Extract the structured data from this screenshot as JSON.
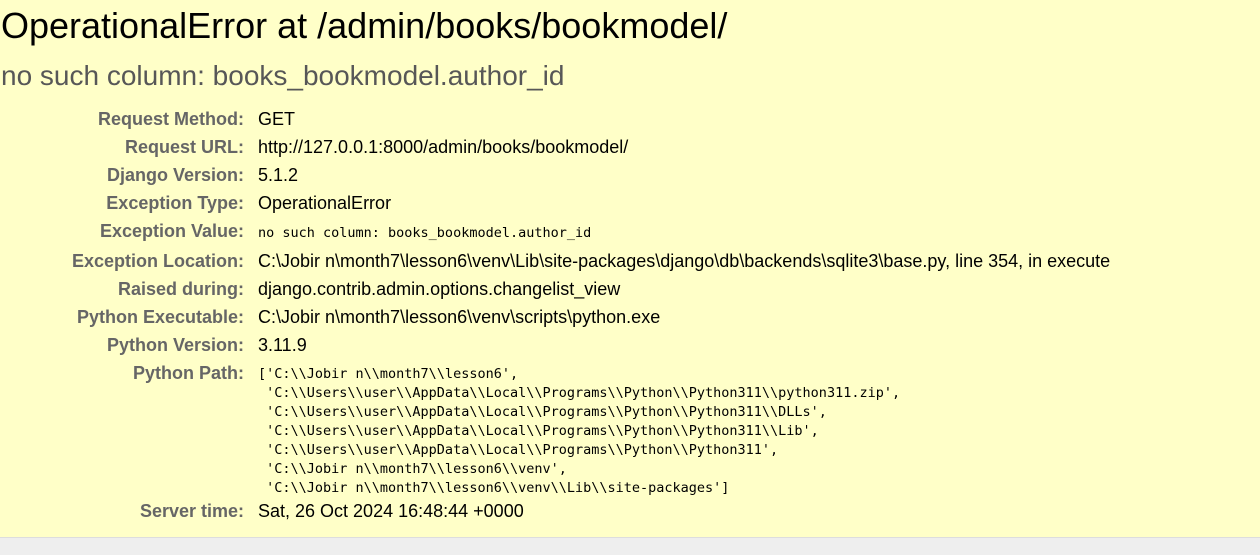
{
  "error": {
    "title": "OperationalError at /admin/books/bookmodel/",
    "message": "no such column: books_bookmodel.author_id"
  },
  "meta": {
    "request_method_label": "Request Method:",
    "request_method": "GET",
    "request_url_label": "Request URL:",
    "request_url": "http://127.0.0.1:8000/admin/books/bookmodel/",
    "django_version_label": "Django Version:",
    "django_version": "5.1.2",
    "exception_type_label": "Exception Type:",
    "exception_type": "OperationalError",
    "exception_value_label": "Exception Value:",
    "exception_value": "no such column: books_bookmodel.author_id",
    "exception_location_label": "Exception Location:",
    "exception_location": "C:\\Jobir n\\month7\\lesson6\\venv\\Lib\\site-packages\\django\\db\\backends\\sqlite3\\base.py, line 354, in execute",
    "raised_during_label": "Raised during:",
    "raised_during": "django.contrib.admin.options.changelist_view",
    "python_executable_label": "Python Executable:",
    "python_executable": "C:\\Jobir n\\month7\\lesson6\\venv\\scripts\\python.exe",
    "python_version_label": "Python Version:",
    "python_version": "3.11.9",
    "python_path_label": "Python Path:",
    "python_path": "['C:\\\\Jobir n\\\\month7\\\\lesson6',\n 'C:\\\\Users\\\\user\\\\AppData\\\\Local\\\\Programs\\\\Python\\\\Python311\\\\python311.zip',\n 'C:\\\\Users\\\\user\\\\AppData\\\\Local\\\\Programs\\\\Python\\\\Python311\\\\DLLs',\n 'C:\\\\Users\\\\user\\\\AppData\\\\Local\\\\Programs\\\\Python\\\\Python311\\\\Lib',\n 'C:\\\\Users\\\\user\\\\AppData\\\\Local\\\\Programs\\\\Python\\\\Python311',\n 'C:\\\\Jobir n\\\\month7\\\\lesson6\\\\venv',\n 'C:\\\\Jobir n\\\\month7\\\\lesson6\\\\venv\\\\Lib\\\\site-packages']",
    "server_time_label": "Server time:",
    "server_time": "Sat, 26 Oct 2024 16:48:44 +0000"
  },
  "colors": {
    "summary_background": "#ffffc8",
    "label_color": "#666666",
    "subtitle_color": "#575757"
  }
}
